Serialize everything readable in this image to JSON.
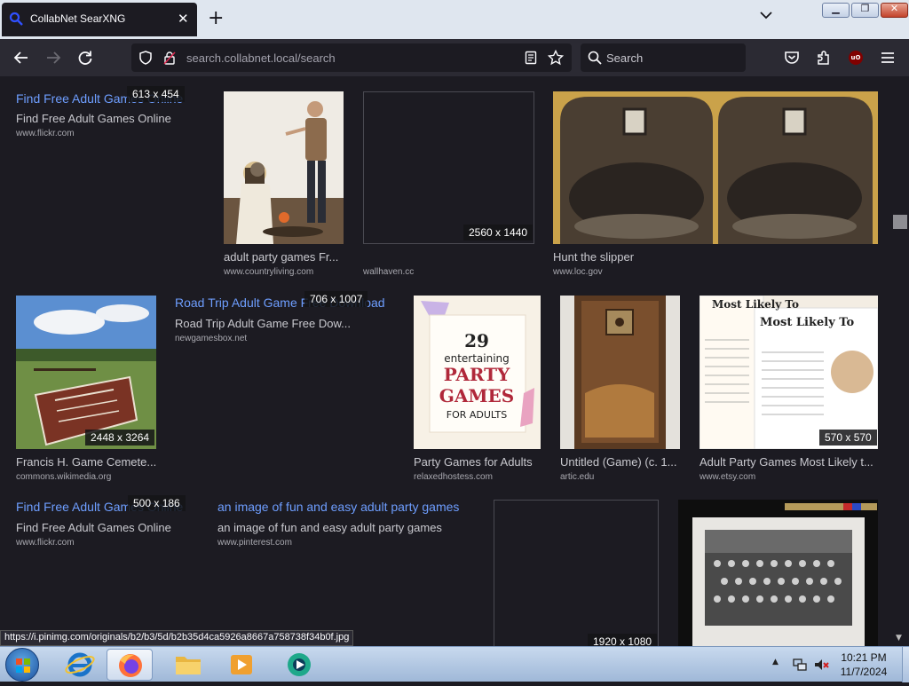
{
  "browser": {
    "tab_title": "CollabNet SearXNG",
    "url_host": "search.collabnet.local",
    "url_path": "/search",
    "search_placeholder": "Search",
    "status_url": "https://i.pinimg.com/originals/b2/b3/5d/b2b35d4ca5926a8667a758738f34b0f.jpg"
  },
  "results": [
    {
      "title": "Find Free Adult Games Online",
      "desc": "Find Free Adult Games Online",
      "source": "www.flickr.com",
      "resolution": "613 x 454"
    },
    {
      "title": "",
      "desc": "adult party games Fr...",
      "source": "www.countryliving.com",
      "resolution": ""
    },
    {
      "title": "",
      "desc": "",
      "source": "wallhaven.cc",
      "resolution": "2560 x 1440"
    },
    {
      "title": "",
      "desc": "Hunt the slipper",
      "source": "www.loc.gov",
      "resolution": ""
    },
    {
      "title": "",
      "desc": "Francis H. Game Cemete...",
      "source": "commons.wikimedia.org",
      "resolution": "2448 x 3264"
    },
    {
      "title": "Road Trip Adult Game Free Download",
      "desc": "Road Trip Adult Game Free Dow...",
      "source": "newgamesbox.net",
      "resolution": "706 x 1007"
    },
    {
      "title": "",
      "desc": "Party Games for Adults",
      "source": "relaxedhostess.com",
      "resolution": "",
      "image_text": [
        "29",
        "entertaining",
        "PARTY",
        "GAMES",
        "FOR ADULTS"
      ]
    },
    {
      "title": "",
      "desc": "Untitled (Game) (c. 1...",
      "source": "artic.edu",
      "resolution": ""
    },
    {
      "title": "",
      "desc": "Adult Party Games Most Likely t...",
      "source": "www.etsy.com",
      "resolution": "570 x 570",
      "image_text": [
        "Most Likely To",
        "Most Likely To"
      ]
    },
    {
      "title": "Find Free Adult Games Online",
      "desc": "Find Free Adult Games Online",
      "source": "www.flickr.com",
      "resolution": "500 x 186"
    },
    {
      "title": "an image of fun and easy adult party games",
      "desc": "an image of fun and easy adult party games",
      "source": "www.pinterest.com",
      "resolution": ""
    },
    {
      "title": "",
      "desc": "",
      "source": "",
      "resolution": "1920 x 1080"
    }
  ],
  "taskbar": {
    "time": "10:21 PM",
    "date": "11/7/2024"
  },
  "colors": {
    "link": "#6e9eff",
    "background": "#1c1b22",
    "toolbar": "#2b2a33"
  }
}
